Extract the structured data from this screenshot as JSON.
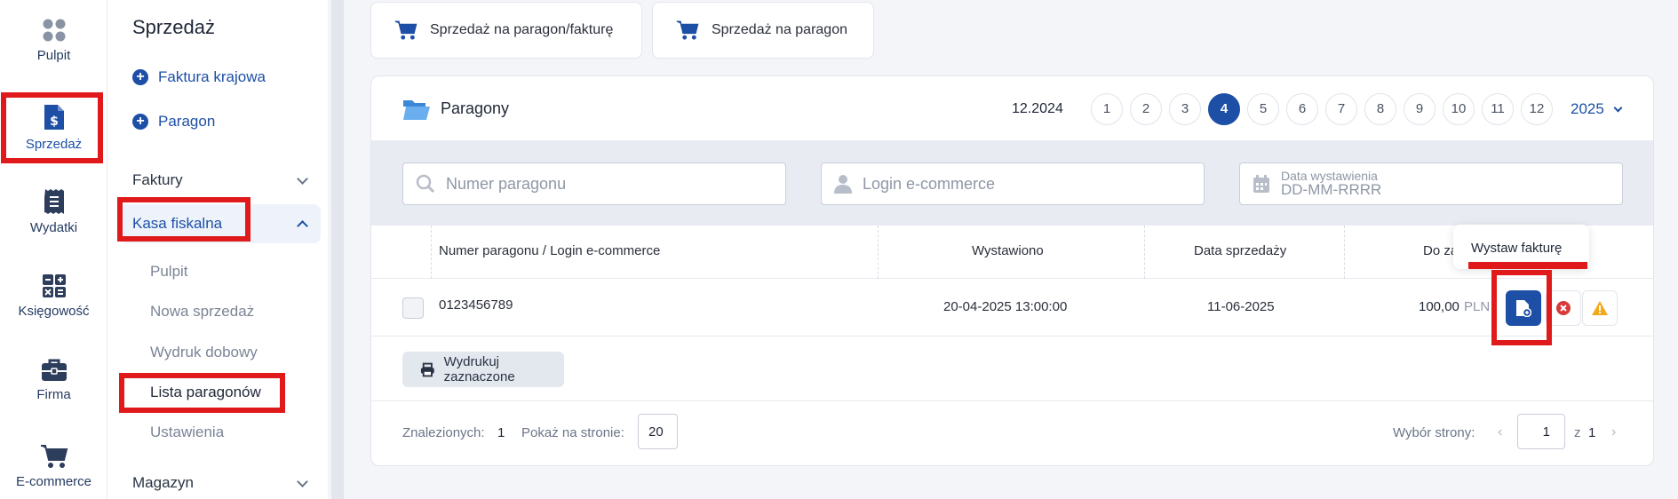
{
  "rail": {
    "items": [
      {
        "label": "Pulpit",
        "icon": "dashboard-icon"
      },
      {
        "label": "Sprzedaż",
        "icon": "invoice-dollar-icon"
      },
      {
        "label": "Wydatki",
        "icon": "receipt-icon"
      },
      {
        "label": "Księgowość",
        "icon": "calculator-icon"
      },
      {
        "label": "Firma",
        "icon": "briefcase-icon"
      },
      {
        "label": "E-commerce",
        "icon": "cart-icon"
      }
    ]
  },
  "subnav": {
    "title": "Sprzedaż",
    "quick": [
      "Faktura krajowa",
      "Paragon"
    ],
    "groups": {
      "faktury": "Faktury",
      "kasa": "Kasa fiskalna",
      "magazyn": "Magazyn"
    },
    "kasa_items": [
      "Pulpit",
      "Nowa sprzedaż",
      "Wydruk dobowy",
      "Lista paragonów",
      "Ustawienia"
    ]
  },
  "top_buttons": [
    "Sprzedaż na paragon/fakturę",
    "Sprzedaż na paragon"
  ],
  "panel": {
    "title": "Paragony",
    "period": "12.2024",
    "months": [
      "1",
      "2",
      "3",
      "4",
      "5",
      "6",
      "7",
      "8",
      "9",
      "10",
      "11",
      "12"
    ],
    "selected_month": "4",
    "year": "2025",
    "filters": {
      "receipt_placeholder": "Numer paragonu",
      "login_placeholder": "Login e-commerce",
      "date_label": "Data wystawienia",
      "date_placeholder": "DD-MM-RRRR"
    },
    "columns": {
      "number": "Numer paragonu / Login e-commerce",
      "issued": "Wystawiono",
      "sale_date": "Data sprzedaży",
      "amount": "Do za"
    },
    "rows": [
      {
        "number": "0123456789",
        "issued": "20-04-2025 13:00:00",
        "sale_date": "11-06-2025",
        "amount": "100,00",
        "currency": "PLN"
      }
    ],
    "tooltip": "Wystaw fakturę",
    "print_button": "Wydrukuj zaznaczone",
    "footer": {
      "found_label": "Znalezionych:",
      "found_value": "1",
      "per_page_label": "Pokaż na stronie:",
      "per_page_value": "20",
      "page_label": "Wybór strony:",
      "page_value": "1",
      "of_label": "z",
      "total_pages": "1"
    }
  },
  "colors": {
    "accent": "#1d4fa6",
    "highlight": "#e01a1a",
    "delete": "#d83a3a",
    "warning": "#f2a91b"
  }
}
